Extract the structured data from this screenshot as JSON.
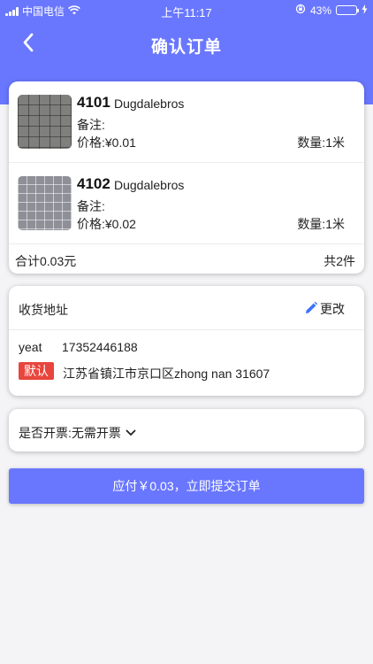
{
  "status_bar": {
    "carrier": "中国电信",
    "time": "上午11:17",
    "battery_percent": "43%",
    "battery_level": 0.43
  },
  "nav": {
    "title": "确认订单",
    "back_icon": "chevron-left-icon"
  },
  "order": {
    "items": [
      {
        "code": "4101",
        "brand": "Dugdalebros",
        "note_label": "备注:",
        "price_text": "价格:¥0.01",
        "qty_text": "数量:1米"
      },
      {
        "code": "4102",
        "brand": "Dugdalebros",
        "note_label": "备注:",
        "price_text": "价格:¥0.02",
        "qty_text": "数量:1米"
      }
    ],
    "total_text": "合计0.03元",
    "count_text": "共2件"
  },
  "address": {
    "section_label": "收货地址",
    "edit_label": "更改",
    "edit_icon": "pencil-icon",
    "name": "yeat",
    "phone": "17352446188",
    "default_badge": "默认",
    "full_address": "江苏省镇江市京口区zhong nan 31607"
  },
  "invoice": {
    "label": "是否开票:",
    "value": "无需开票",
    "chevron_icon": "chevron-down-icon"
  },
  "submit": {
    "label": "应付￥0.03，立即提交订单"
  },
  "colors": {
    "accent": "#6977ff",
    "badge": "#e8453c",
    "edit_icon": "#3b72ff",
    "battery_fill": "#4cd964"
  }
}
